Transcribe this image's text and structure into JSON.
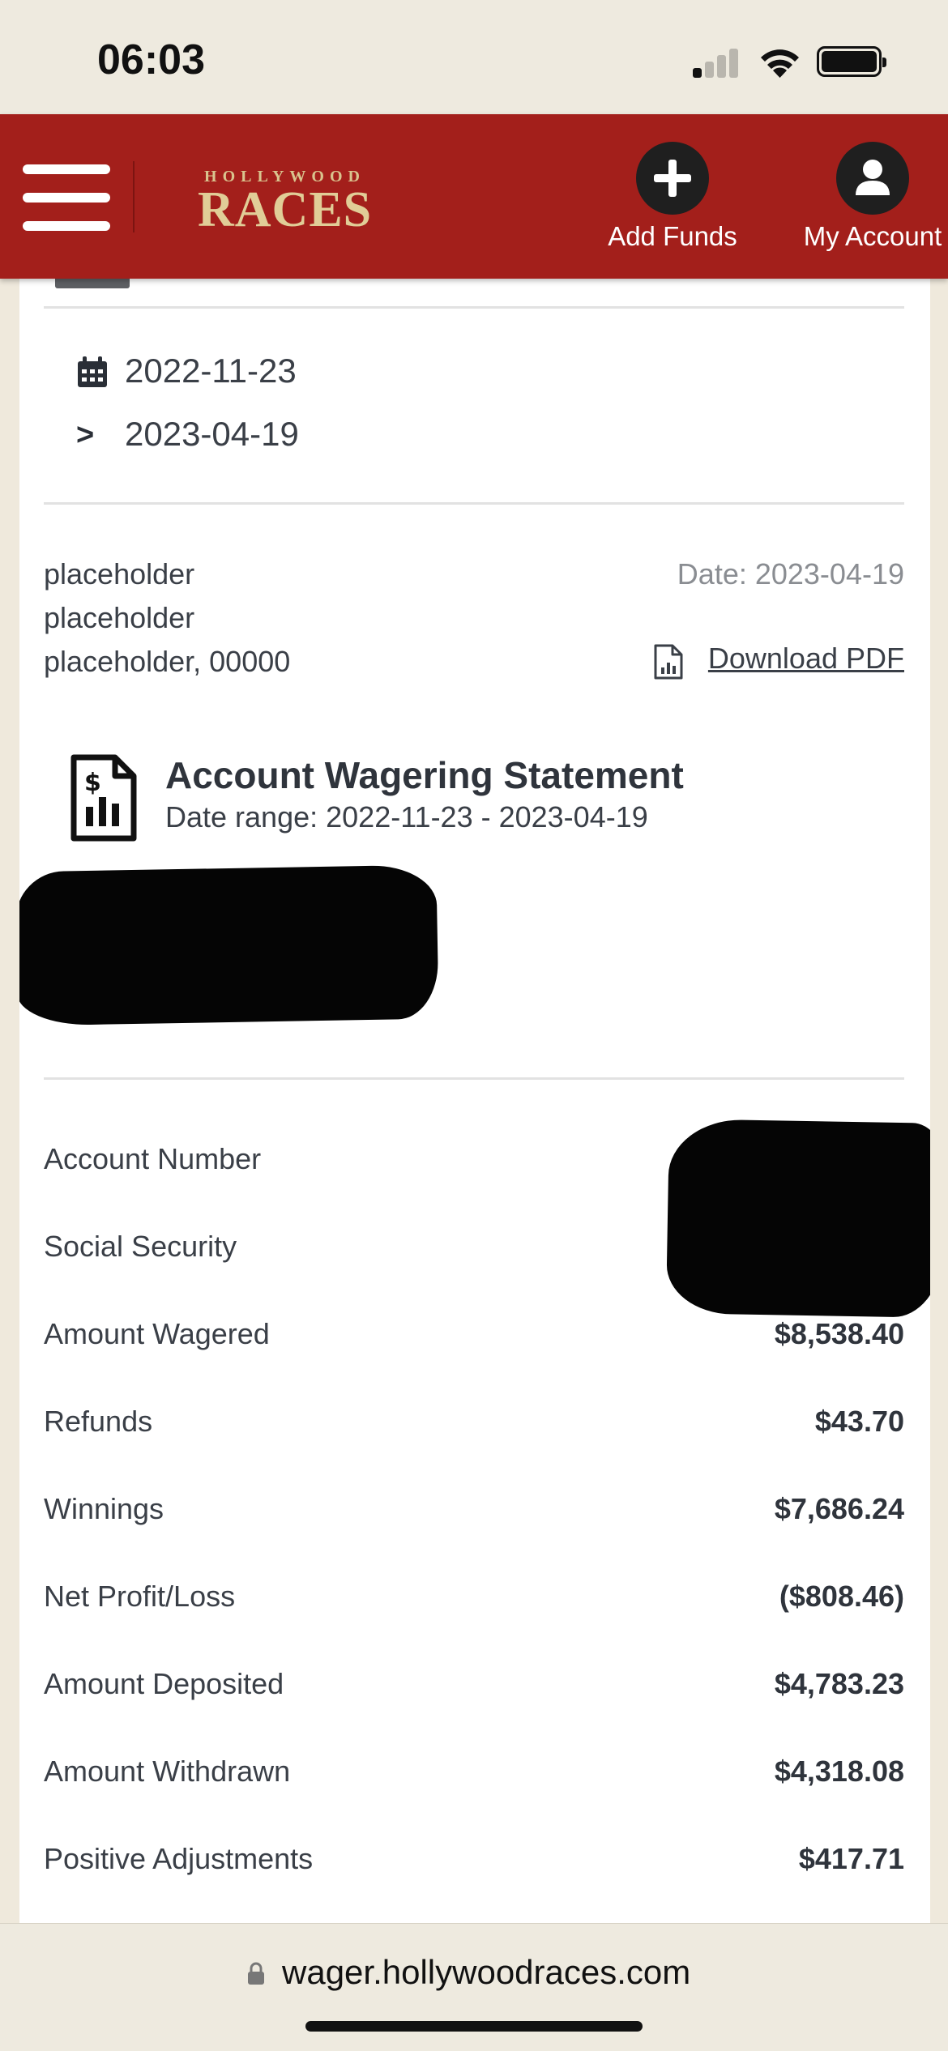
{
  "status_bar": {
    "time": "06:03"
  },
  "header": {
    "menu_icon": "hamburger-icon",
    "logo_top": "HOLLYWOOD",
    "logo_main": "RACES",
    "add_funds_label": "Add Funds",
    "my_account_label": "My Account",
    "background_color": "#a31f1b"
  },
  "date_range": {
    "start": "2022-11-23",
    "arrow": ">",
    "end": "2023-04-19"
  },
  "address": {
    "line1": "placeholder",
    "line2": "placeholder",
    "line3": "placeholder, 00000"
  },
  "meta": {
    "date": "Date: 2023-04-19",
    "download_label": "Download PDF"
  },
  "statement": {
    "title": "Account Wagering Statement",
    "range": "Date range: 2022-11-23 - 2023-04-19"
  },
  "summary": [
    {
      "label": "Account Number",
      "value": ""
    },
    {
      "label": "Social Security",
      "value": ""
    },
    {
      "label": "Amount Wagered",
      "value": "$8,538.40"
    },
    {
      "label": "Refunds",
      "value": "$43.70"
    },
    {
      "label": "Winnings",
      "value": "$7,686.24"
    },
    {
      "label": "Net Profit/Loss",
      "value": "($808.46)"
    },
    {
      "label": "Amount Deposited",
      "value": "$4,783.23"
    },
    {
      "label": "Amount Withdrawn",
      "value": "$4,318.08"
    },
    {
      "label": "Positive Adjustments",
      "value": "$417.71"
    }
  ],
  "browser": {
    "url": "wager.hollywoodraces.com"
  }
}
